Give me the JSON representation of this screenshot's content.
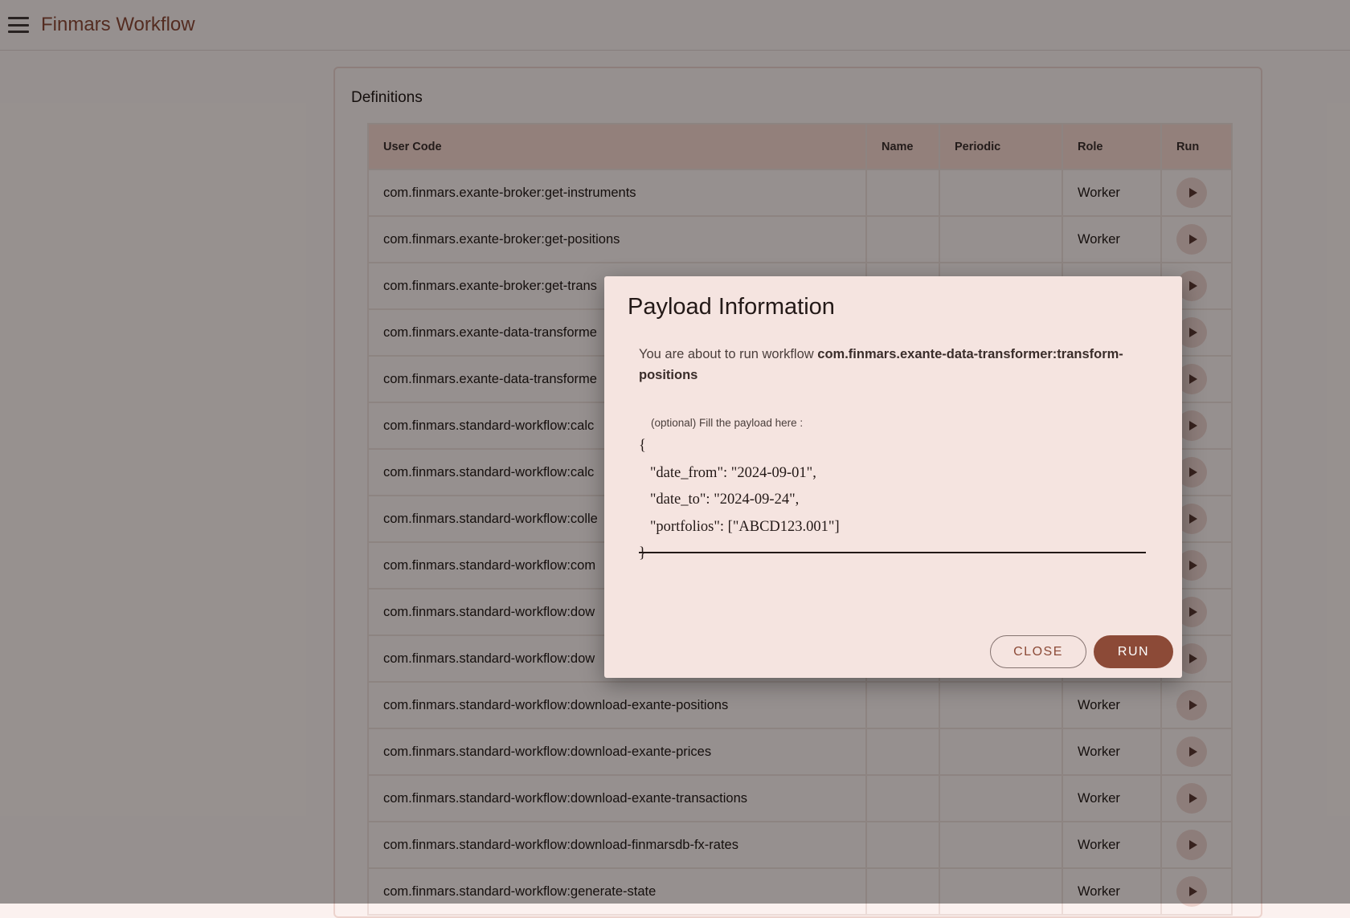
{
  "app": {
    "title": "Finmars Workflow",
    "menu_icon": "hamburger-menu-icon"
  },
  "definitions": {
    "title": "Definitions",
    "columns": [
      "User Code",
      "Name",
      "Periodic",
      "Role",
      "Run"
    ],
    "rows": [
      {
        "user_code": "com.finmars.exante-broker:get-instruments",
        "name": "",
        "periodic": "",
        "role": "Worker"
      },
      {
        "user_code": "com.finmars.exante-broker:get-positions",
        "name": "",
        "periodic": "",
        "role": "Worker"
      },
      {
        "user_code": "com.finmars.exante-broker:get-trans",
        "name": "",
        "periodic": "",
        "role": ""
      },
      {
        "user_code": "com.finmars.exante-data-transforme",
        "name": "",
        "periodic": "",
        "role": ""
      },
      {
        "user_code": "com.finmars.exante-data-transforme",
        "name": "",
        "periodic": "",
        "role": ""
      },
      {
        "user_code": "com.finmars.standard-workflow:calc",
        "name": "",
        "periodic": "",
        "role": ""
      },
      {
        "user_code": "com.finmars.standard-workflow:calc",
        "name": "",
        "periodic": "",
        "role": ""
      },
      {
        "user_code": "com.finmars.standard-workflow:colle",
        "name": "",
        "periodic": "",
        "role": ""
      },
      {
        "user_code": "com.finmars.standard-workflow:com",
        "name": "",
        "periodic": "",
        "role": ""
      },
      {
        "user_code": "com.finmars.standard-workflow:dow",
        "name": "",
        "periodic": "",
        "role": ""
      },
      {
        "user_code": "com.finmars.standard-workflow:dow",
        "name": "",
        "periodic": "",
        "role": ""
      },
      {
        "user_code": "com.finmars.standard-workflow:download-exante-positions",
        "name": "",
        "periodic": "",
        "role": "Worker"
      },
      {
        "user_code": "com.finmars.standard-workflow:download-exante-prices",
        "name": "",
        "periodic": "",
        "role": "Worker"
      },
      {
        "user_code": "com.finmars.standard-workflow:download-exante-transactions",
        "name": "",
        "periodic": "",
        "role": "Worker"
      },
      {
        "user_code": "com.finmars.standard-workflow:download-finmarsdb-fx-rates",
        "name": "",
        "periodic": "",
        "role": "Worker"
      },
      {
        "user_code": "com.finmars.standard-workflow:generate-state",
        "name": "",
        "periodic": "",
        "role": "Worker"
      }
    ]
  },
  "dialog": {
    "title": "Payload Information",
    "message_prefix": "You are about to run workflow ",
    "workflow_code": "com.finmars.exante-data-transformer:transform-positions",
    "payload_label": "(optional) Fill the payload here :",
    "payload_text": "{\n   \"date_from\": \"2024-09-01\",\n   \"date_to\": \"2024-09-24\",\n   \"portfolios\": [\"ABCD123.001\"]\n}",
    "close_label": "CLOSE",
    "run_label": "RUN"
  },
  "colors": {
    "primary": "#8c4a37",
    "header_bg": "#f5d6cd",
    "dialog_bg": "#f5e4e0",
    "overlay": "rgba(0,0,0,0.40)"
  }
}
